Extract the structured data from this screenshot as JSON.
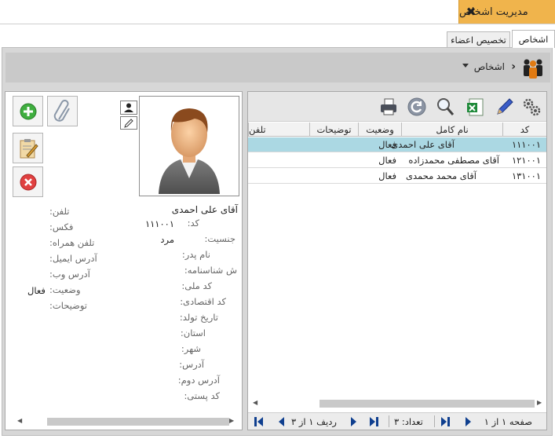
{
  "window": {
    "title": "مدیریت اشخاص"
  },
  "tabs": [
    {
      "label": "اشخاص",
      "active": true
    },
    {
      "label": "تخصیص اعضاء",
      "active": false
    }
  ],
  "breadcrumb": {
    "label": "اشخاص"
  },
  "colors": {
    "accent": "#f0b44c",
    "selected_row": "#abd8e3",
    "nav_blue": "#0f3f8f"
  },
  "side_buttons": [
    {
      "name": "add-button",
      "icon": "plus-icon"
    },
    {
      "name": "attach-button",
      "icon": "paperclip-icon"
    },
    {
      "name": "edit-button",
      "icon": "clipboard-edit-icon"
    },
    {
      "name": "delete-button",
      "icon": "delete-icon"
    }
  ],
  "detail": {
    "name": "آقای علی احمدی",
    "fields_right": [
      {
        "label": "کد:",
        "value": "۱۱۱۰۰۱"
      },
      {
        "label": "جنسیت:",
        "value": "مرد"
      },
      {
        "label": "نام پدر:",
        "value": ""
      },
      {
        "label": "ش شناسنامه:",
        "value": ""
      },
      {
        "label": "کد ملی:",
        "value": ""
      },
      {
        "label": "کد اقتصادی:",
        "value": ""
      },
      {
        "label": "تاریخ تولد:",
        "value": ""
      },
      {
        "label": "استان:",
        "value": ""
      },
      {
        "label": "شهر:",
        "value": ""
      },
      {
        "label": "آدرس:",
        "value": ""
      },
      {
        "label": "آدرس دوم:",
        "value": ""
      },
      {
        "label": "کد پستی:",
        "value": ""
      }
    ],
    "fields_left": [
      {
        "label": "تلفن:",
        "value": ""
      },
      {
        "label": "فکس:",
        "value": ""
      },
      {
        "label": "تلفن همراه:",
        "value": ""
      },
      {
        "label": "آدرس ایمیل:",
        "value": ""
      },
      {
        "label": "آدرس وب:",
        "value": ""
      },
      {
        "label": "وضعیت:",
        "value": "فعال"
      },
      {
        "label": "توضیحات:",
        "value": ""
      }
    ]
  },
  "toolbar": [
    {
      "name": "settings-icon"
    },
    {
      "name": "pen-icon"
    },
    {
      "name": "excel-icon"
    },
    {
      "name": "search-icon"
    },
    {
      "name": "refresh-icon"
    },
    {
      "name": "print-icon"
    }
  ],
  "grid": {
    "columns": [
      "کد",
      "نام کامل",
      "وضعیت",
      "توضیحات",
      "تلفن"
    ],
    "rows": [
      {
        "code": "۱۱۱۰۰۱",
        "name": "آقای علی احمدی",
        "status": "فعال",
        "selected": true
      },
      {
        "code": "۱۲۱۰۰۱",
        "name": "آقای مصطفی محمدزاده",
        "status": "فعال",
        "selected": false
      },
      {
        "code": "۱۳۱۰۰۱",
        "name": "آقای محمد محمدی",
        "status": "فعال",
        "selected": false
      }
    ]
  },
  "pager": {
    "page_text": "صفحه ۱ از ۱",
    "count_text": "تعداد: ۳",
    "row_text": "ردیف ۱ از ۳"
  }
}
